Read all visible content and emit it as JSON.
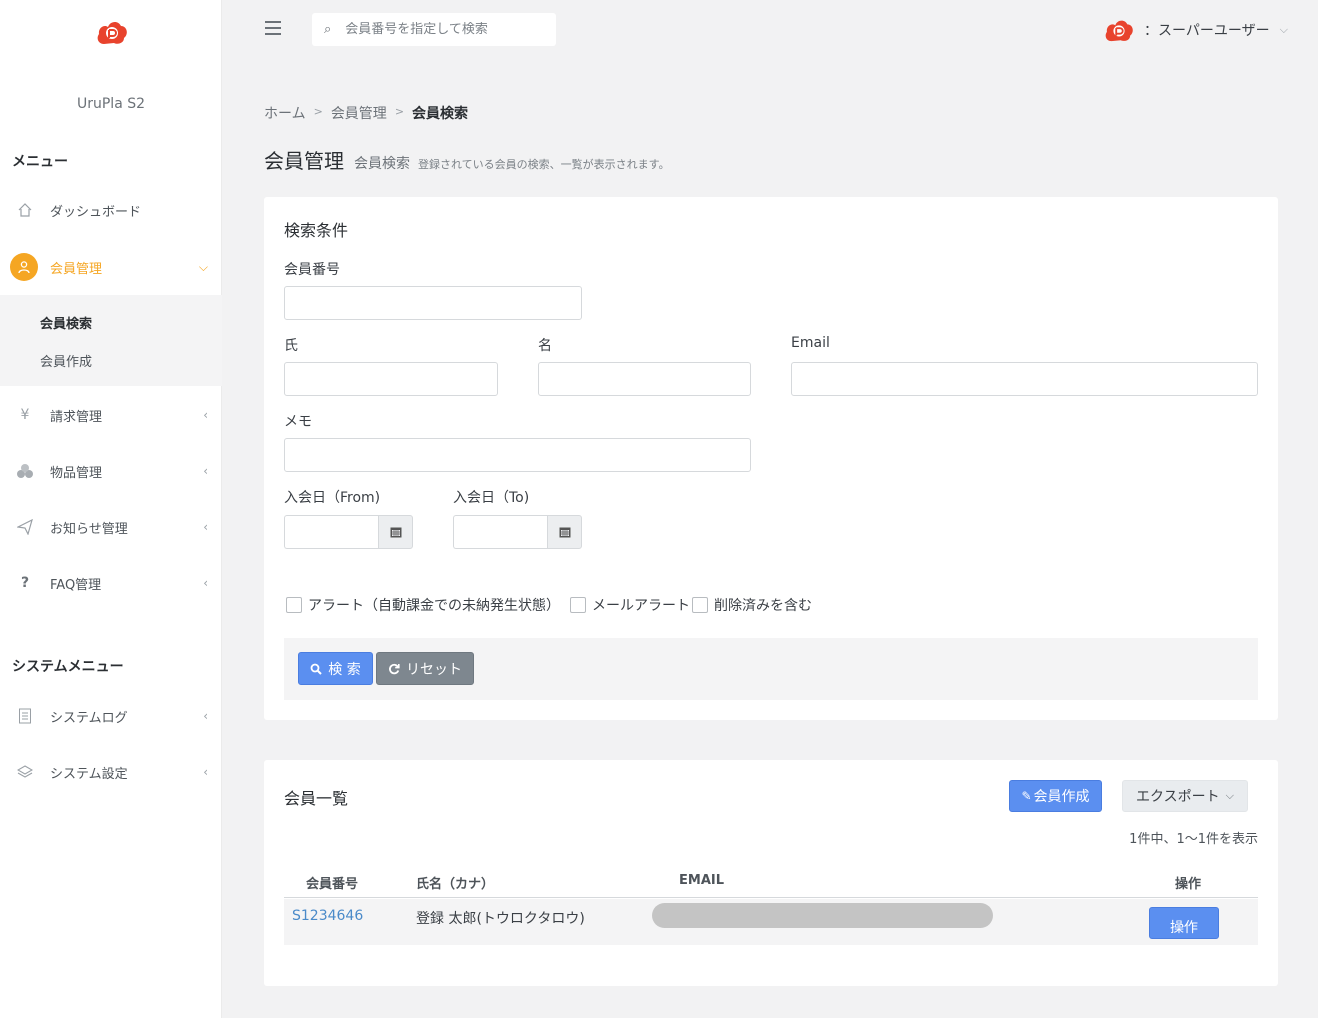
{
  "app": {
    "name": "UruPla S2",
    "brand_color": "#e8432d",
    "accent": "#f5a623"
  },
  "sidebar": {
    "menu_heading": "メニュー",
    "items": [
      {
        "label": "ダッシュボード",
        "icon": "home-icon"
      },
      {
        "label": "会員管理",
        "icon": "user-icon",
        "active": true
      },
      {
        "label": "請求管理",
        "icon": "yen-icon"
      },
      {
        "label": "物品管理",
        "icon": "boxes-icon"
      },
      {
        "label": "お知らせ管理",
        "icon": "paper-plane-icon"
      },
      {
        "label": "FAQ管理",
        "icon": "question-icon"
      }
    ],
    "sub_items": [
      {
        "label": "会員検索",
        "active": true
      },
      {
        "label": "会員作成"
      }
    ],
    "system_heading": "システムメニュー",
    "system_items": [
      {
        "label": "システムログ",
        "icon": "document-icon"
      },
      {
        "label": "システム設定",
        "icon": "layers-icon"
      }
    ]
  },
  "topbar": {
    "search_placeholder": "会員番号を指定して検索",
    "user_label": "：スーパーユーザー"
  },
  "breadcrumb": [
    "ホーム",
    "会員管理",
    "会員検索"
  ],
  "page": {
    "title": "会員管理",
    "subtitle": "会員検索",
    "description": "登録されている会員の検索、一覧が表示されます。"
  },
  "search_form": {
    "title": "検索条件",
    "member_no_label": "会員番号",
    "last_name_label": "氏",
    "first_name_label": "名",
    "email_label": "Email",
    "memo_label": "メモ",
    "join_from_label": "入会日（From)",
    "join_to_label": "入会日（To)",
    "checkbox_alert": "アラート（自動課金での未納発生状態）",
    "checkbox_mail_alert": "メールアラート",
    "checkbox_deleted": "削除済みを含む",
    "search_button": "検 索",
    "reset_button": "リセット"
  },
  "member_list": {
    "title": "会員一覧",
    "create_button": "会員作成",
    "export_button": "エクスポート",
    "count_text": "1件中、1〜1件を表示",
    "columns": [
      "会員番号",
      "氏名（カナ）",
      "EMAIL",
      "操作"
    ],
    "rows": [
      {
        "member_no": "S1234646",
        "name": "登録 太郎(トウロクタロウ)",
        "action": "操作"
      }
    ]
  }
}
